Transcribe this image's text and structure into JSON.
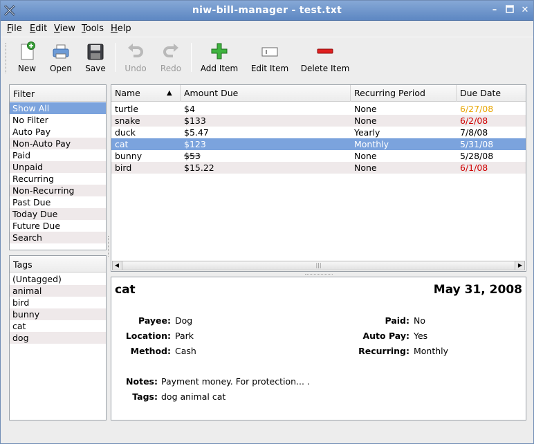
{
  "window": {
    "title": "niw-bill-manager - test.txt"
  },
  "menu": [
    {
      "label": "File",
      "u": "F",
      "rest": "ile"
    },
    {
      "label": "Edit",
      "u": "E",
      "rest": "dit"
    },
    {
      "label": "View",
      "u": "V",
      "rest": "iew"
    },
    {
      "label": "Tools",
      "u": "T",
      "rest": "ools"
    },
    {
      "label": "Help",
      "u": "H",
      "rest": "elp"
    }
  ],
  "toolbar": {
    "new_label": "New",
    "open_label": "Open",
    "save_label": "Save",
    "undo_label": "Undo",
    "redo_label": "Redo",
    "add_label": "Add Item",
    "edit_label": "Edit Item",
    "delete_label": "Delete Item"
  },
  "filter": {
    "header": "Filter",
    "items": [
      "Show All",
      "No Filter",
      "Auto Pay",
      "Non-Auto Pay",
      "Paid",
      "Unpaid",
      "Recurring",
      "Non-Recurring",
      "Past Due",
      "Today Due",
      "Future Due",
      "Search"
    ],
    "selected": "Show All"
  },
  "tags": {
    "header": "Tags",
    "items": [
      "(Untagged)",
      "animal",
      "bird",
      "bunny",
      "cat",
      "dog"
    ]
  },
  "bills": {
    "columns": [
      "Name",
      "Amount Due",
      "Recurring Period",
      "Due Date"
    ],
    "sort_indicator": "▲",
    "rows": [
      {
        "name": "turtle",
        "amount": "$4",
        "period": "None",
        "due": "6/27/08",
        "due_color": "#e8a500",
        "struck": false,
        "selected": false
      },
      {
        "name": "snake",
        "amount": "$133",
        "period": "None",
        "due": "6/2/08",
        "due_color": "#d00000",
        "struck": false,
        "selected": false
      },
      {
        "name": "duck",
        "amount": "$5.47",
        "period": "Yearly",
        "due": "7/8/08",
        "due_color": "#000000",
        "struck": false,
        "selected": false
      },
      {
        "name": "cat",
        "amount": "$123",
        "period": "Monthly",
        "due": "5/31/08",
        "due_color": "#ffffff",
        "struck": false,
        "selected": true
      },
      {
        "name": "bunny",
        "amount": "$53",
        "period": "None",
        "due": "5/28/08",
        "due_color": "#000000",
        "struck": true,
        "selected": false
      },
      {
        "name": "bird",
        "amount": "$15.22",
        "period": "None",
        "due": "6/1/08",
        "due_color": "#d00000",
        "struck": false,
        "selected": false
      }
    ]
  },
  "details": {
    "name": "cat",
    "date": "May 31, 2008",
    "payee_label": "Payee:",
    "payee": "Dog",
    "location_label": "Location:",
    "location": "Park",
    "method_label": "Method:",
    "method": "Cash",
    "paid_label": "Paid:",
    "paid": "No",
    "autopay_label": "Auto Pay:",
    "autopay": "Yes",
    "recurring_label": "Recurring:",
    "recurring": "Monthly",
    "notes_label": "Notes:",
    "notes": "Payment money. For protection... .",
    "tags_label": "Tags:",
    "tags": "dog animal cat"
  },
  "colors": {
    "selection": "#7ba3dd",
    "alt_row": "#efe9ea",
    "titlebar": "#5d87c2"
  }
}
